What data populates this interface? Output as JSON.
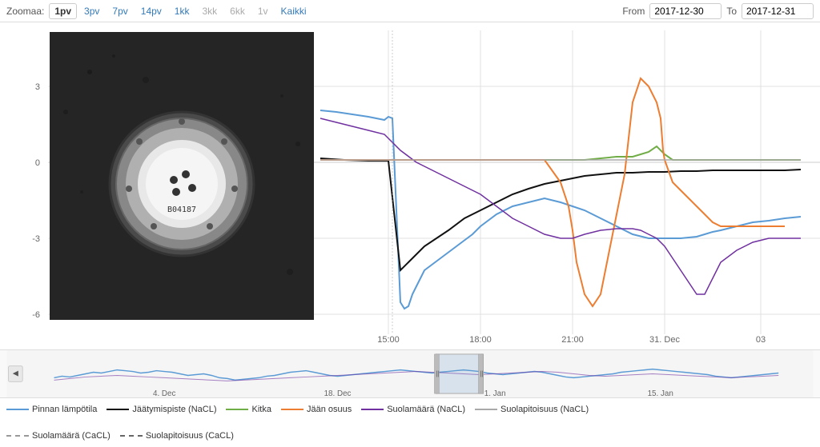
{
  "header": {
    "zoom_label": "Zoomaa:",
    "zoom_buttons": [
      {
        "label": "1pv",
        "active": true,
        "disabled": false
      },
      {
        "label": "3pv",
        "active": false,
        "disabled": false
      },
      {
        "label": "7pv",
        "active": false,
        "disabled": false
      },
      {
        "label": "14pv",
        "active": false,
        "disabled": false
      },
      {
        "label": "1kk",
        "active": false,
        "disabled": false
      },
      {
        "label": "3kk",
        "active": false,
        "disabled": true
      },
      {
        "label": "6kk",
        "active": false,
        "disabled": true
      },
      {
        "label": "1v",
        "active": false,
        "disabled": true
      },
      {
        "label": "Kaikki",
        "active": false,
        "disabled": false
      }
    ],
    "from_label": "From",
    "from_value": "2017-12-30",
    "to_label": "To",
    "to_value": "2017-12-31"
  },
  "chart": {
    "y_axis_labels": [
      "3",
      "0",
      "-3",
      "-6"
    ],
    "x_axis_labels": [
      "15:00",
      "18:00",
      "21:00",
      "31. Dec",
      "03"
    ],
    "mini_x_labels": [
      "4. Dec",
      "18. Dec",
      "1. Jan",
      "15. Jan"
    ]
  },
  "legend": {
    "items": [
      {
        "label": "Pinnan lämpötila",
        "color": "#5b9bd5",
        "dashed": false
      },
      {
        "label": "Jäätymispiste (NaCL)",
        "color": "#000000",
        "dashed": false
      },
      {
        "label": "Kitka",
        "color": "#70ad47",
        "dashed": false
      },
      {
        "label": "Jään osuus",
        "color": "#ed7d31",
        "dashed": false
      },
      {
        "label": "Suolamäärä (NaCL)",
        "color": "#7030a0",
        "dashed": false
      },
      {
        "label": "Suolapitoisuus (NaCL)",
        "color": "#a9a9a9",
        "dashed": false
      },
      {
        "label": "Suolamäärä (CaCL)",
        "color": "#999999",
        "dashed": true
      },
      {
        "label": "Suolapitoisuus (CaCL)",
        "color": "#666666",
        "dashed": true
      }
    ]
  }
}
